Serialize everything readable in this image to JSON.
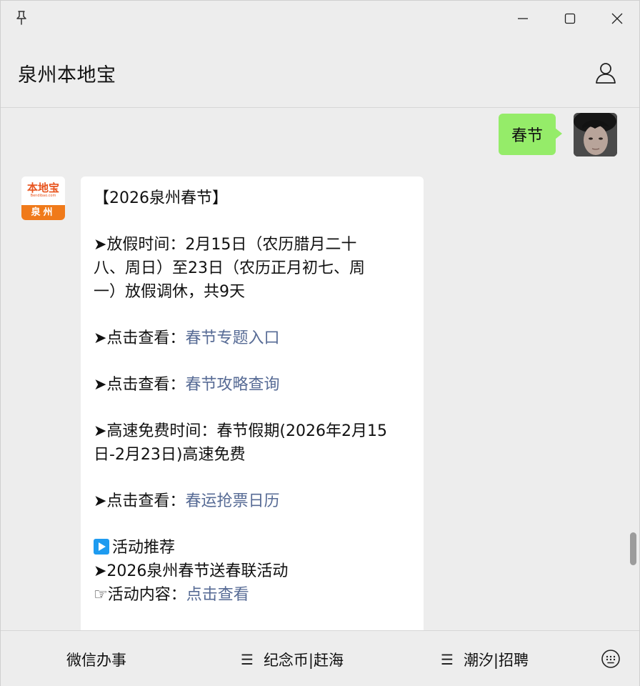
{
  "window": {
    "title": "泉州本地宝"
  },
  "chat": {
    "self_message": "春节",
    "bot_message": {
      "heading": "【2026泉州春节】",
      "holiday_line1": "➤放假时间：2月15日（农历腊月二十",
      "holiday_line2": "八、周日）至23日（农历正月初七、周",
      "holiday_line3": "一）放假调休，共9天",
      "view_prefix_1": "➤点击查看：",
      "link_1": "春节专题入口",
      "view_prefix_2": "➤点击查看：",
      "link_2": "春节攻略查询",
      "highway_line1": "➤高速免费时间：春节假期(2026年2月15",
      "highway_line2": "日-2月23日)高速免费",
      "view_prefix_3": "➤点击查看：",
      "link_3": "春运抢票日历",
      "activity_title": "活动推荐",
      "activity_name": "➤2026泉州春节送春联活动",
      "content_prefix": "☞活动内容：",
      "link_4": "点击查看"
    },
    "bot_avatar": {
      "logo_text": "本地宝",
      "logo_url": "Bendibao.com",
      "logo_city": "泉州"
    }
  },
  "bottom_menu": {
    "item1": "微信办事",
    "item2_icon": "☰",
    "item2": "纪念币|赶海",
    "item3_icon": "☰",
    "item3": "潮汐|招聘"
  },
  "icons": {
    "pin": "pin-icon",
    "minimize": "minimize-icon",
    "maximize": "maximize-icon",
    "close": "close-icon",
    "profile": "profile-icon",
    "keyboard": "keyboard-icon"
  },
  "colors": {
    "self_bubble": "#95ec69",
    "link": "#576b95",
    "background": "#ededed"
  }
}
